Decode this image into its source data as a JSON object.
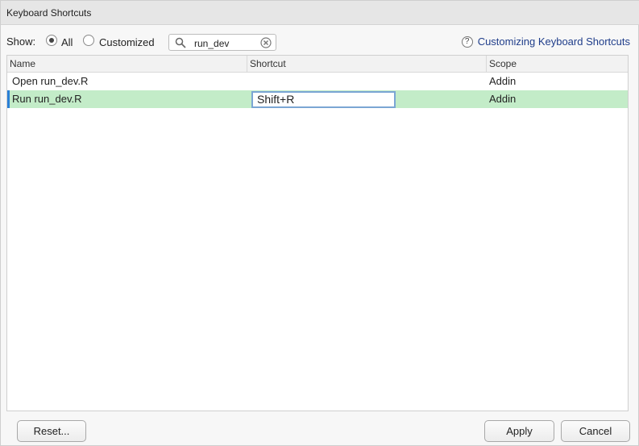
{
  "window": {
    "title": "Keyboard Shortcuts"
  },
  "toolbar": {
    "show_label": "Show:",
    "filters": [
      {
        "label": "All",
        "checked": true
      },
      {
        "label": "Customized",
        "checked": false
      }
    ],
    "search": {
      "value": "run_dev"
    },
    "help_link": "Customizing Keyboard Shortcuts"
  },
  "table": {
    "columns": [
      "Name",
      "Shortcut",
      "Scope"
    ],
    "rows": [
      {
        "name": "Open run_dev.R",
        "shortcut": "",
        "scope": "Addin",
        "selected": false
      },
      {
        "name": "Run run_dev.R",
        "shortcut": "Shift+R",
        "scope": "Addin",
        "selected": true
      }
    ]
  },
  "buttons": {
    "reset": "Reset...",
    "apply": "Apply",
    "cancel": "Cancel"
  },
  "colors": {
    "selected_row": "#c3ecc8",
    "link": "#1f3d8a",
    "focus": "#7ba6d4"
  }
}
